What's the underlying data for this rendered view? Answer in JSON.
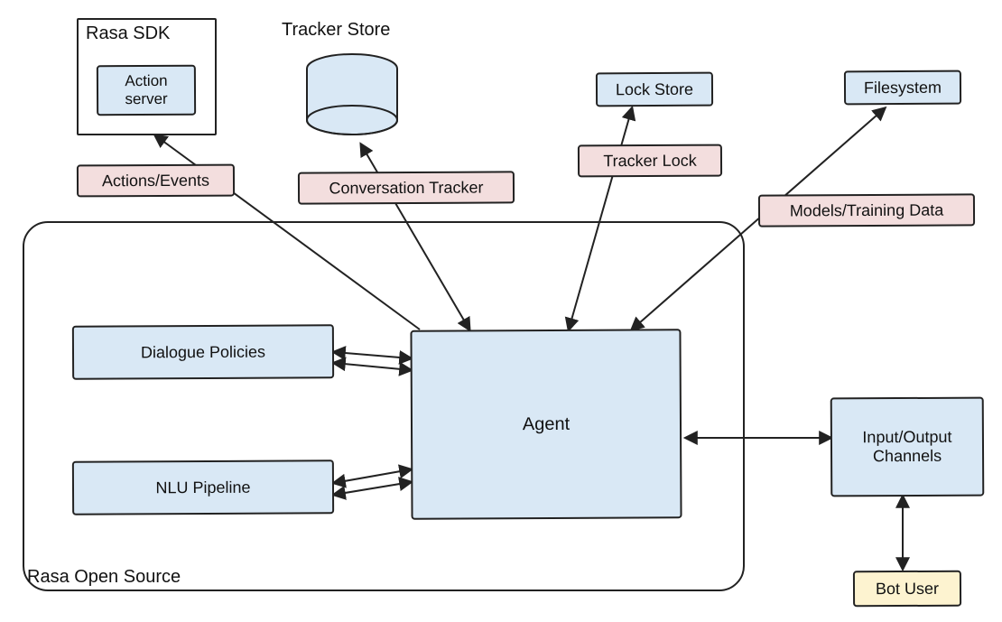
{
  "title_open_source": "Rasa Open Source",
  "title_sdk": "Rasa SDK",
  "title_tracker_store": "Tracker Store",
  "box_action_server": "Action server",
  "box_lock_store": "Lock Store",
  "box_filesystem": "Filesystem",
  "box_dialogue_policies": "Dialogue Policies",
  "box_nlu_pipeline": "NLU Pipeline",
  "box_agent": "Agent",
  "box_io_channels": "Input/Output Channels",
  "box_bot_user": "Bot User",
  "edge_actions_events": "Actions/Events",
  "edge_conversation_tracker": "Conversation Tracker",
  "edge_tracker_lock": "Tracker Lock",
  "edge_models_training": "Models/Training Data",
  "colors": {
    "blue": "#d9e8f5",
    "pink": "#f3dede",
    "yellow": "#fdf3d0",
    "stroke": "#222222"
  }
}
